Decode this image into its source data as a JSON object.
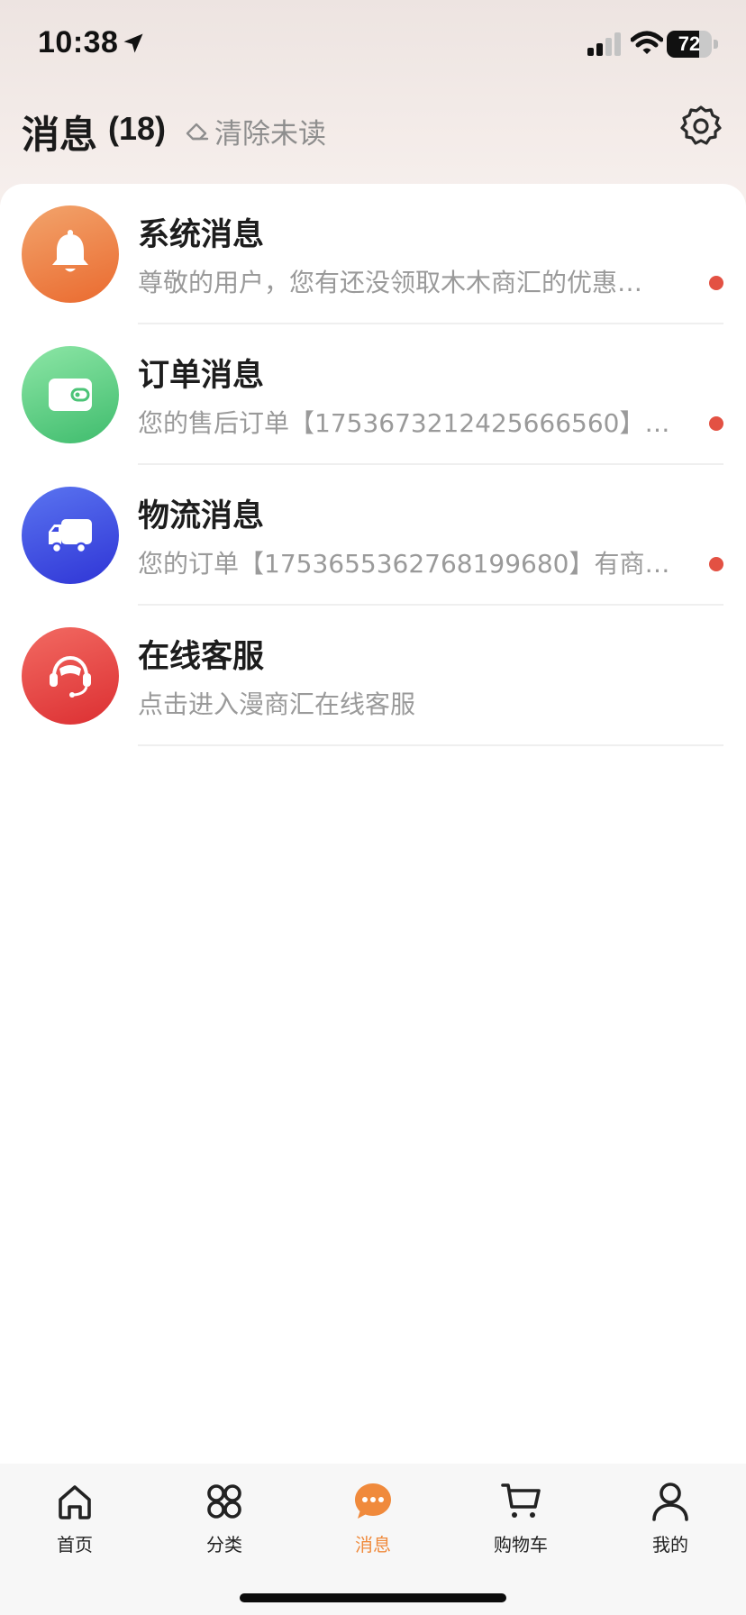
{
  "status_bar": {
    "time": "10:38",
    "battery": "72",
    "battery_level": 0.72
  },
  "header": {
    "title": "消息",
    "count": "(18)",
    "clear_unread": "清除未读"
  },
  "messages": [
    {
      "title": "系统消息",
      "preview": "尊敬的用户，您有还没领取木木商汇的优惠…",
      "unread": true,
      "icon": "bell-icon",
      "color": "#ef7a3e"
    },
    {
      "title": "订单消息",
      "preview": "您的售后订单【1753673212425666560】…",
      "unread": true,
      "icon": "wallet-icon",
      "color": "#53c97f"
    },
    {
      "title": "物流消息",
      "preview": "您的订单【1753655362768199680】有商…",
      "unread": true,
      "icon": "truck-icon",
      "color": "#3f4ee6"
    },
    {
      "title": "在线客服",
      "preview": "点击进入漫商汇在线客服",
      "unread": false,
      "icon": "headset-icon",
      "color": "#e84444"
    }
  ],
  "tabs": [
    {
      "label": "首页",
      "icon": "home-icon",
      "active": false
    },
    {
      "label": "分类",
      "icon": "category-icon",
      "active": false
    },
    {
      "label": "消息",
      "icon": "message-icon",
      "active": true
    },
    {
      "label": "购物车",
      "icon": "cart-icon",
      "active": false
    },
    {
      "label": "我的",
      "icon": "profile-icon",
      "active": false
    }
  ],
  "colors": {
    "accent": "#f08a3c",
    "unread_dot": "#e35143",
    "preview_text": "#9a9a9a"
  }
}
